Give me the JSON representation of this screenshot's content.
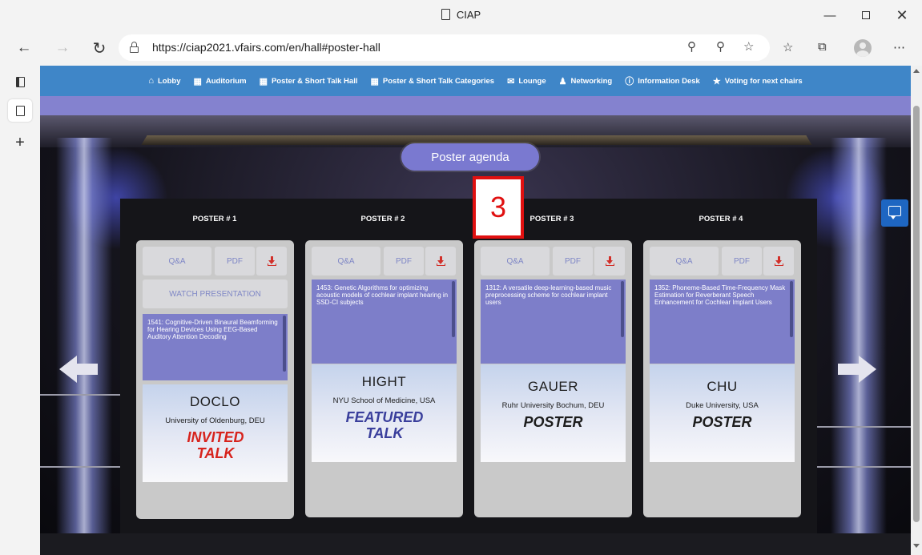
{
  "browser": {
    "tab_title": "CIAP",
    "url": "https://ciap2021.vfairs.com/en/hall#poster-hall"
  },
  "nav": {
    "items": [
      {
        "label": "Lobby",
        "icon": "home-icon"
      },
      {
        "label": "Auditorium",
        "icon": "grid-icon"
      },
      {
        "label": "Poster & Short Talk Hall",
        "icon": "grid-icon"
      },
      {
        "label": "Poster & Short Talk Categories",
        "icon": "grid-icon"
      },
      {
        "label": "Lounge",
        "icon": "chat-icon"
      },
      {
        "label": "Networking",
        "icon": "person-icon"
      },
      {
        "label": "Information Desk",
        "icon": "info-icon"
      },
      {
        "label": "Voting for next chairs",
        "icon": "star-icon"
      }
    ]
  },
  "hall": {
    "agenda_label": "Poster agenda",
    "annotation": "3",
    "posters": [
      {
        "label": "POSTER # 1",
        "qa": "Q&A",
        "pdf": "PDF",
        "watch": "WATCH PRESENTATION",
        "abstract": "1541: Cognitive-Driven Binaural Beamforming for Hearing Devices Using EEG-Based Auditory Attention Decoding",
        "name": "DOCLO",
        "affiliation": "University of Oldenburg, DEU",
        "type": "INVITED TALK",
        "type_color": "#d7231d"
      },
      {
        "label": "POSTER # 2",
        "qa": "Q&A",
        "pdf": "PDF",
        "abstract": "1453: Genetic Algorithms for optimizing acoustic models of cochlear implant hearing in SSD-CI subjects",
        "name": "HIGHT",
        "affiliation": "NYU School of Medicine, USA",
        "type": "FEATURED TALK",
        "type_color": "#3a3f9c"
      },
      {
        "label": "POSTER # 3",
        "qa": "Q&A",
        "pdf": "PDF",
        "abstract": "1312: A versatile deep-learning-based music preprocessing scheme for cochlear implant users",
        "name": "GAUER",
        "affiliation": "Ruhr University Bochum, DEU",
        "type": "POSTER",
        "type_color": "#1d1d1d"
      },
      {
        "label": "POSTER # 4",
        "qa": "Q&A",
        "pdf": "PDF",
        "abstract": "1352: Phoneme-Based Time-Frequency Mask Estimation for Reverberant Speech Enhancement for Cochlear Implant Users",
        "name": "CHU",
        "affiliation": "Duke University, USA",
        "type": "POSTER",
        "type_color": "#1d1d1d"
      }
    ]
  }
}
